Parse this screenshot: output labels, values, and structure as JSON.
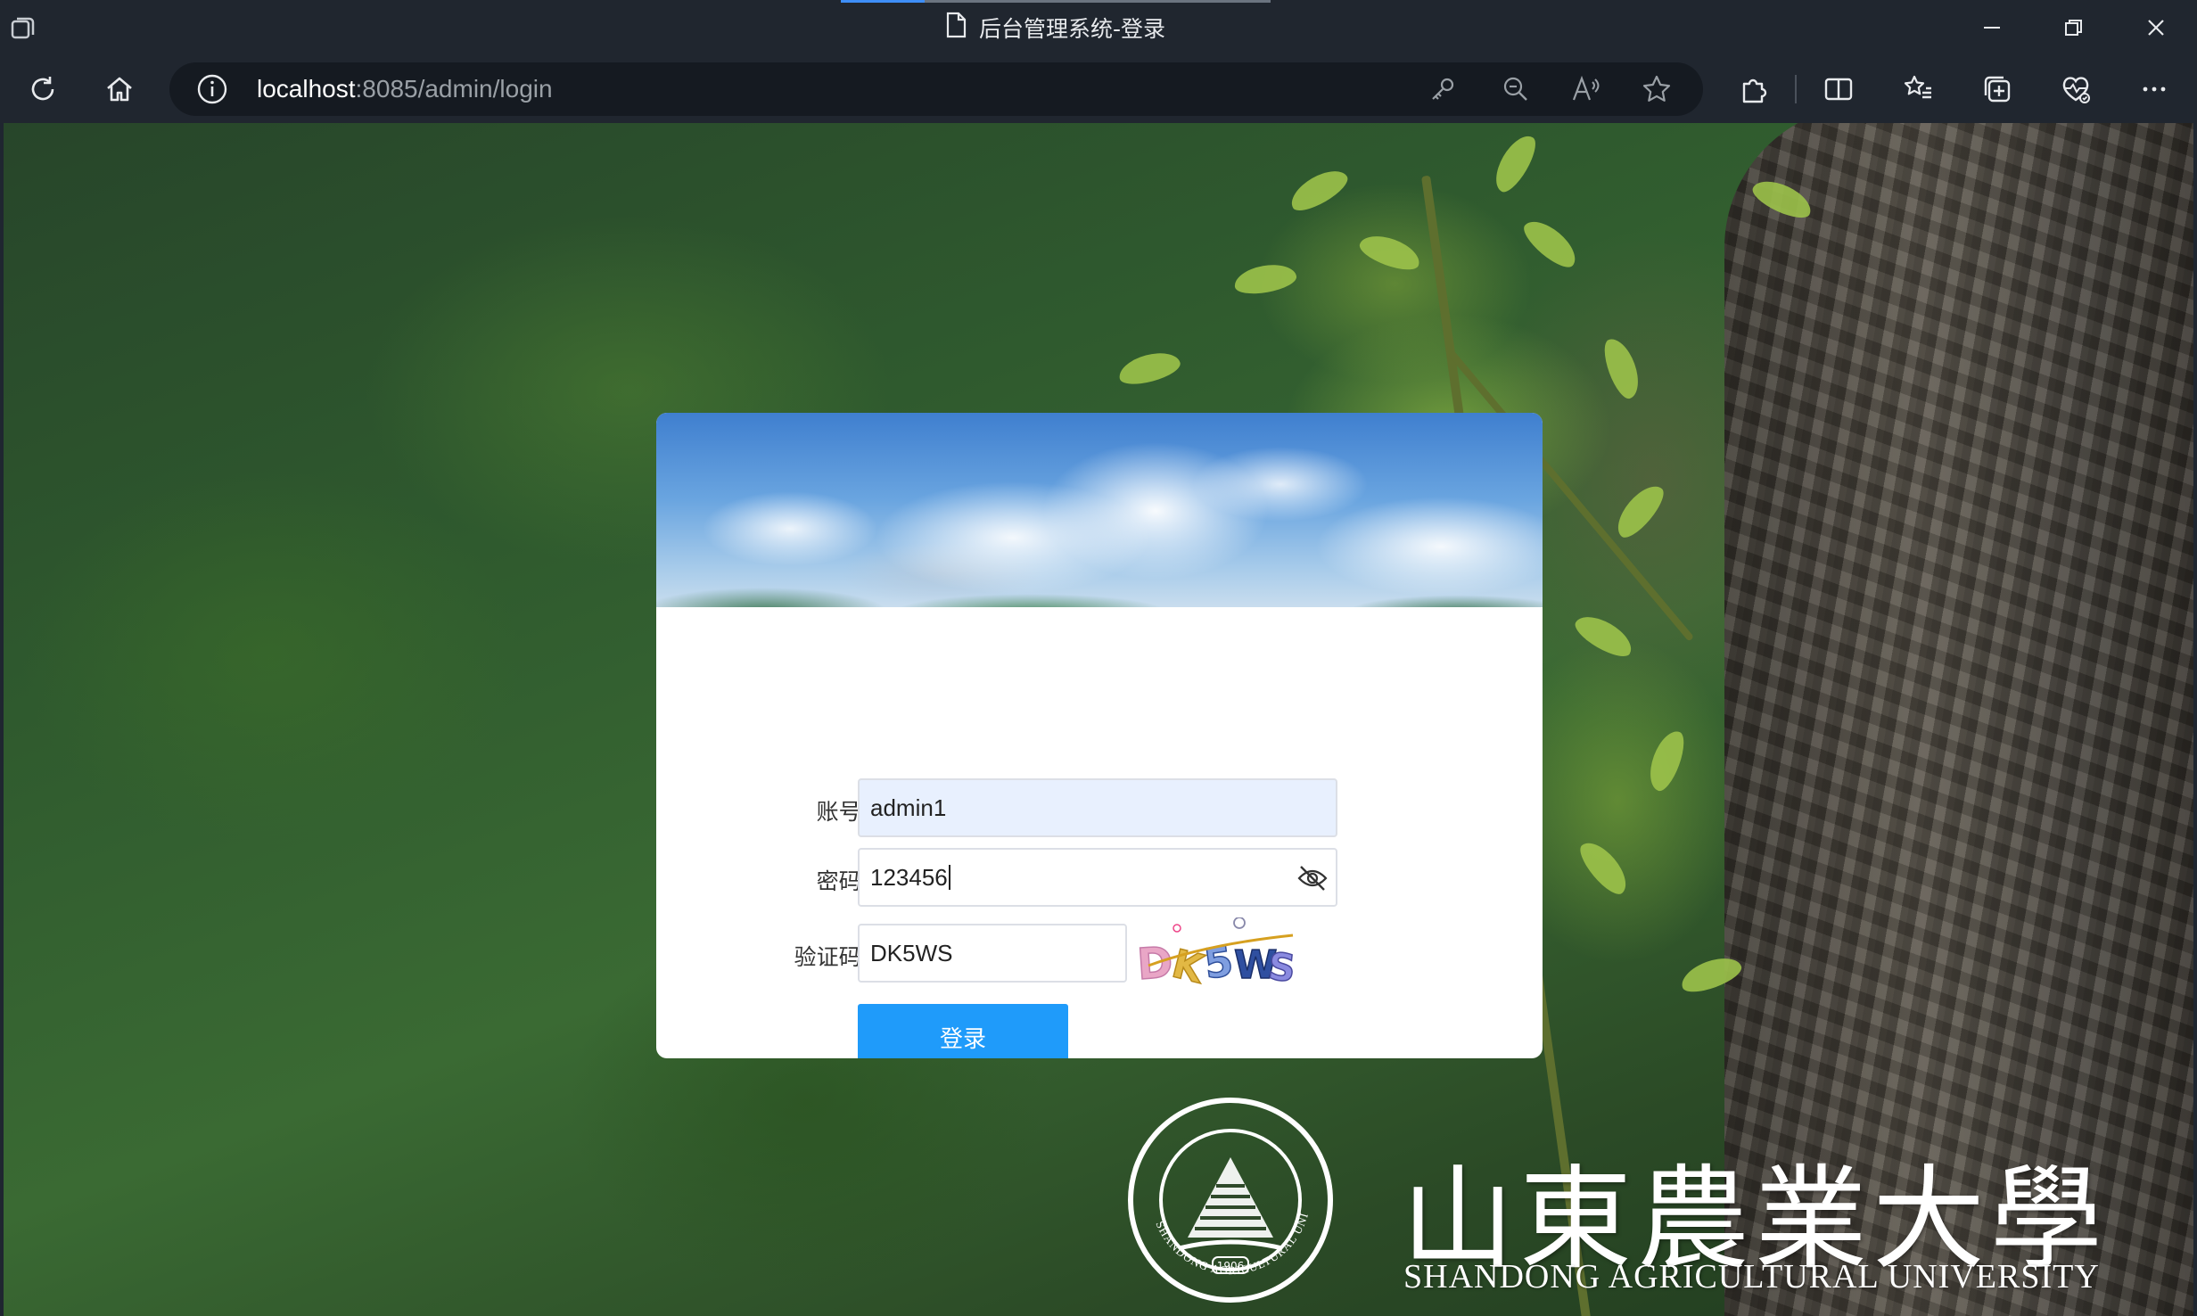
{
  "browser": {
    "tab_title": "后台管理系统-登录",
    "url_host": "localhost",
    "url_rest": ":8085/admin/login"
  },
  "login": {
    "account_label": "账号:",
    "account_value": "admin1",
    "password_label": "密码:",
    "password_value": "123456",
    "captcha_label": "验证码:",
    "captcha_value": "DK5WS",
    "captcha_image_text": "DK5WS",
    "submit_label": "登录"
  },
  "university": {
    "name_cn": "山東農業大學",
    "name_en": "SHANDONG AGRICULTURAL UNIVERSITY",
    "seal_year": "1906"
  },
  "colors": {
    "button_primary": "#1f9bfa",
    "browser_chrome": "#20262f"
  }
}
